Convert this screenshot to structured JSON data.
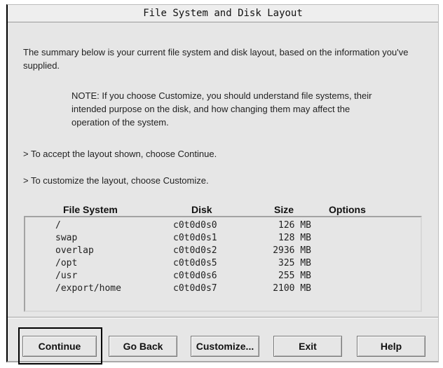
{
  "window": {
    "title": "File System and Disk Layout"
  },
  "text": {
    "intro": "The summary below is your current file system and disk layout, based on the information you've supplied.",
    "note": "NOTE: If you choose Customize, you should understand file systems, their intended purpose on the disk, and how changing them may affect the operation of the system.",
    "accept": "> To accept the layout shown, choose Continue.",
    "customize": "> To customize the layout, choose Customize."
  },
  "table": {
    "headers": {
      "file_system": "File System",
      "disk": "Disk",
      "size": "Size",
      "options": "Options"
    },
    "rows": [
      {
        "fs": "/",
        "disk": "c0t0d0s0",
        "size": "126 MB",
        "options": ""
      },
      {
        "fs": "swap",
        "disk": "c0t0d0s1",
        "size": "128 MB",
        "options": ""
      },
      {
        "fs": "overlap",
        "disk": "c0t0d0s2",
        "size": "2936 MB",
        "options": ""
      },
      {
        "fs": "/opt",
        "disk": "c0t0d0s5",
        "size": "325 MB",
        "options": ""
      },
      {
        "fs": "/usr",
        "disk": "c0t0d0s6",
        "size": "255 MB",
        "options": ""
      },
      {
        "fs": "/export/home",
        "disk": "c0t0d0s7",
        "size": "2100 MB",
        "options": ""
      }
    ]
  },
  "buttons": {
    "continue": "Continue",
    "go_back": "Go Back",
    "customize": "Customize...",
    "exit": "Exit",
    "help": "Help"
  }
}
